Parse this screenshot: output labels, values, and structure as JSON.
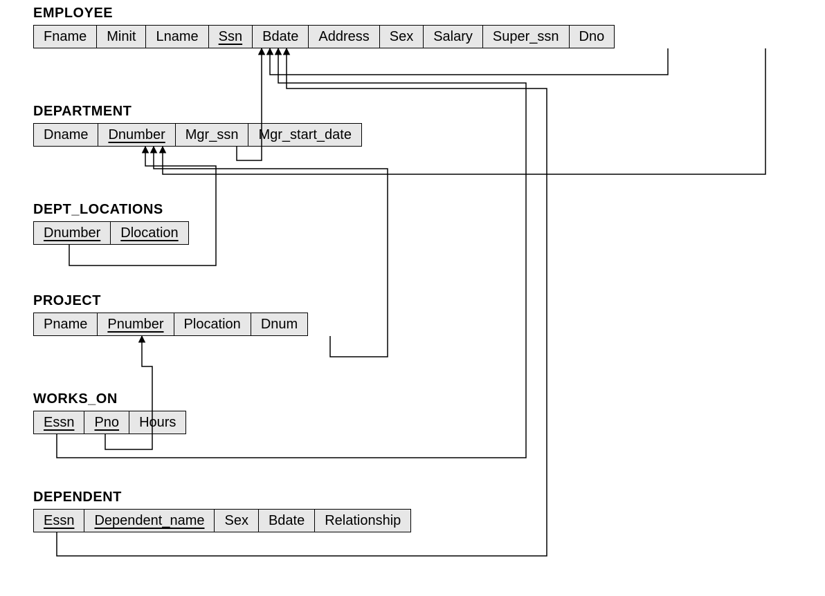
{
  "tables": {
    "employee": {
      "title": "EMPLOYEE",
      "attrs": [
        {
          "name": "Fname",
          "key": false
        },
        {
          "name": "Minit",
          "key": false
        },
        {
          "name": "Lname",
          "key": false
        },
        {
          "name": "Ssn",
          "key": true
        },
        {
          "name": "Bdate",
          "key": false
        },
        {
          "name": "Address",
          "key": false
        },
        {
          "name": "Sex",
          "key": false
        },
        {
          "name": "Salary",
          "key": false
        },
        {
          "name": "Super_ssn",
          "key": false
        },
        {
          "name": "Dno",
          "key": false
        }
      ]
    },
    "department": {
      "title": "DEPARTMENT",
      "attrs": [
        {
          "name": "Dname",
          "key": false
        },
        {
          "name": "Dnumber",
          "key": true
        },
        {
          "name": "Mgr_ssn",
          "key": false
        },
        {
          "name": "Mgr_start_date",
          "key": false
        }
      ]
    },
    "dept_locations": {
      "title": "DEPT_LOCATIONS",
      "attrs": [
        {
          "name": "Dnumber",
          "key": true
        },
        {
          "name": "Dlocation",
          "key": true
        }
      ]
    },
    "project": {
      "title": "PROJECT",
      "attrs": [
        {
          "name": "Pname",
          "key": false
        },
        {
          "name": "Pnumber",
          "key": true
        },
        {
          "name": "Plocation",
          "key": false
        },
        {
          "name": "Dnum",
          "key": false
        }
      ]
    },
    "works_on": {
      "title": "WORKS_ON",
      "attrs": [
        {
          "name": "Essn",
          "key": true
        },
        {
          "name": "Pno",
          "key": true
        },
        {
          "name": "Hours",
          "key": false
        }
      ]
    },
    "dependent": {
      "title": "DEPENDENT",
      "attrs": [
        {
          "name": "Essn",
          "key": true
        },
        {
          "name": "Dependent_name",
          "key": true
        },
        {
          "name": "Sex",
          "key": false
        },
        {
          "name": "Bdate",
          "key": false
        },
        {
          "name": "Relationship",
          "key": false
        }
      ]
    }
  },
  "foreign_keys": [
    {
      "from": "EMPLOYEE.Super_ssn",
      "to": "EMPLOYEE.Ssn"
    },
    {
      "from": "EMPLOYEE.Dno",
      "to": "DEPARTMENT.Dnumber"
    },
    {
      "from": "DEPARTMENT.Mgr_ssn",
      "to": "EMPLOYEE.Ssn"
    },
    {
      "from": "DEPT_LOCATIONS.Dnumber",
      "to": "DEPARTMENT.Dnumber"
    },
    {
      "from": "PROJECT.Dnum",
      "to": "DEPARTMENT.Dnumber"
    },
    {
      "from": "WORKS_ON.Essn",
      "to": "EMPLOYEE.Ssn"
    },
    {
      "from": "WORKS_ON.Pno",
      "to": "PROJECT.Pnumber"
    },
    {
      "from": "DEPENDENT.Essn",
      "to": "EMPLOYEE.Ssn"
    }
  ]
}
